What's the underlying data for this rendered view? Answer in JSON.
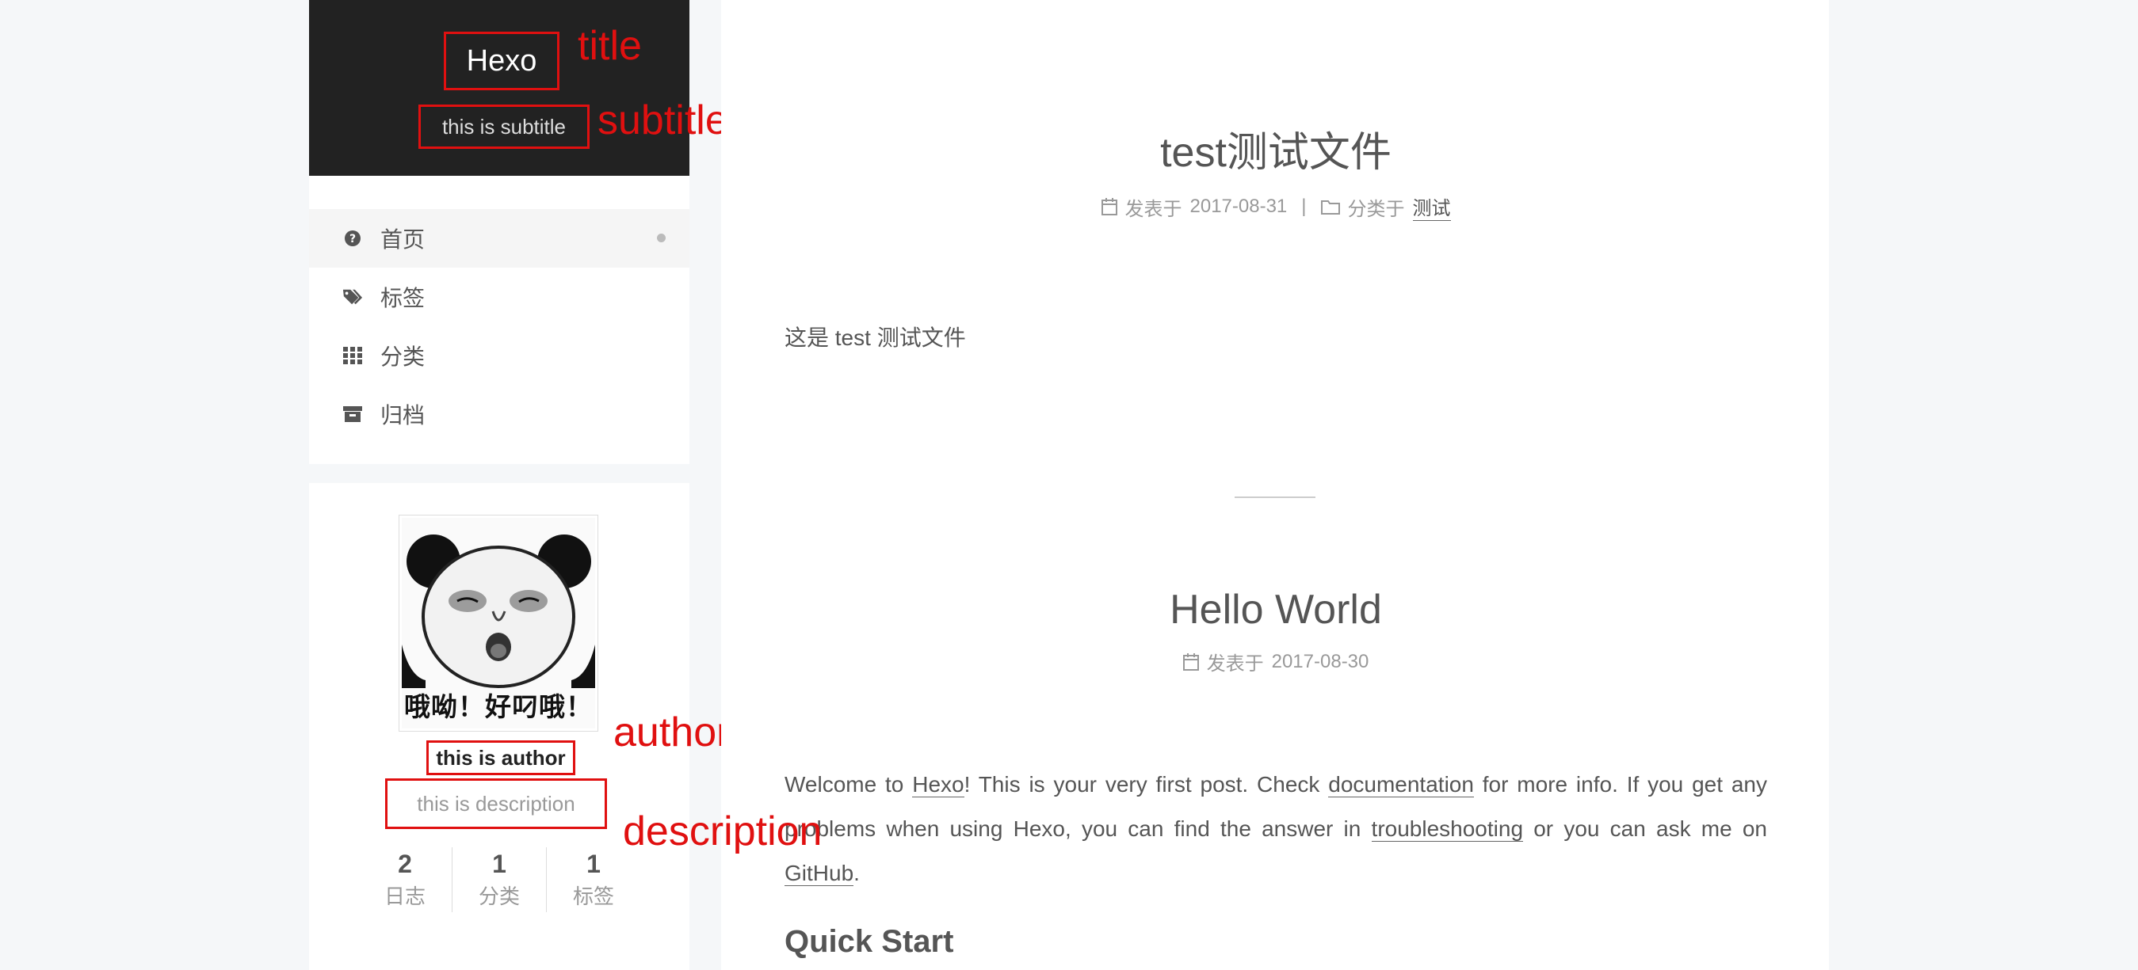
{
  "sidebar": {
    "brand": {
      "title": "Hexo",
      "subtitle": "this is subtitle"
    },
    "menu": [
      {
        "label": "首页",
        "icon": "question-circle-icon",
        "active": true
      },
      {
        "label": "标签",
        "icon": "tags-icon",
        "active": false
      },
      {
        "label": "分类",
        "icon": "grid-icon",
        "active": false
      },
      {
        "label": "归档",
        "icon": "archive-icon",
        "active": false
      }
    ],
    "overview": {
      "avatar_caption": "哦呦！好叼哦！",
      "author": "this is author",
      "description": "this is description",
      "stats": [
        {
          "count": "2",
          "name": "日志"
        },
        {
          "count": "1",
          "name": "分类"
        },
        {
          "count": "1",
          "name": "标签"
        }
      ]
    }
  },
  "annotations": {
    "title": "title",
    "subtitle": "subtitle",
    "author": "author",
    "description": "description"
  },
  "posts": [
    {
      "title": "test测试文件",
      "published_prefix": "发表于",
      "date": "2017-08-31",
      "separator": "|",
      "category_prefix": "分类于",
      "category": "测试",
      "body": "这是 test 测试文件"
    },
    {
      "title": "Hello World",
      "published_prefix": "发表于",
      "date": "2017-08-30",
      "body": {
        "p1_a": "Welcome to ",
        "link_hexo": "Hexo",
        "p1_b": "! This is your very first post. Check ",
        "link_docs": "documentation",
        "p1_c": " for more info. If you get any problems when using Hexo, you can find the answer in ",
        "link_trouble": "troubleshooting",
        "p1_d": " or you can ask me on ",
        "link_github": "GitHub",
        "p1_e": ".",
        "heading": "Quick Start"
      }
    }
  ],
  "colors": {
    "background": "#f5f7f9",
    "brand_bg": "#222222",
    "annotation": "#e01010"
  }
}
